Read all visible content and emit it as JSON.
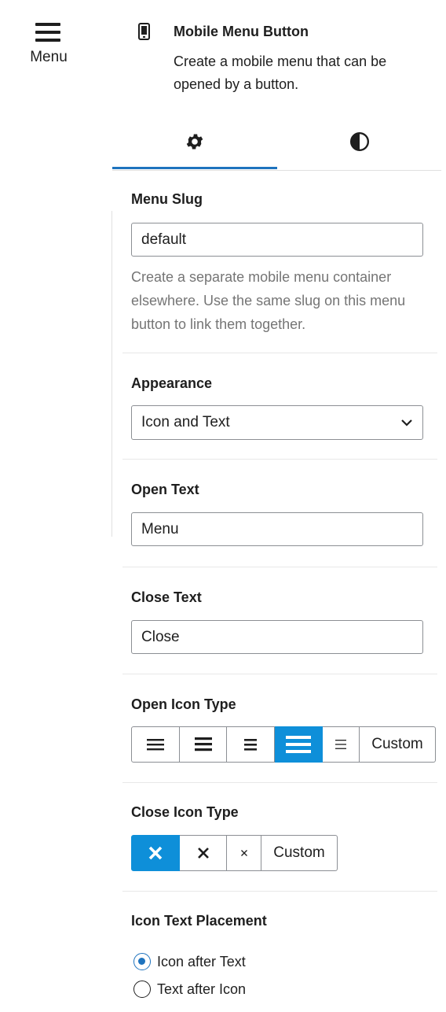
{
  "preview": {
    "label": "Menu",
    "icon": "hamburger-icon"
  },
  "block": {
    "title": "Mobile Menu Button",
    "description": "Create a mobile menu that can be opened by a button.",
    "icon": "mobile-device-icon"
  },
  "tabs": [
    {
      "name": "settings",
      "icon": "gear-icon",
      "active": true
    },
    {
      "name": "styles",
      "icon": "contrast-icon",
      "active": false
    }
  ],
  "panels": {
    "menu_slug": {
      "label": "Menu Slug",
      "value": "default",
      "help": "Create a separate mobile menu container elsewhere. Use the same slug on this menu button to link them together."
    },
    "appearance": {
      "label": "Appearance",
      "selected": "Icon and Text"
    },
    "open_text": {
      "label": "Open Text",
      "value": "Menu"
    },
    "close_text": {
      "label": "Close Text",
      "value": "Close"
    },
    "open_icon_type": {
      "label": "Open Icon Type",
      "options": [
        "menu-icon-1",
        "menu-icon-2",
        "menu-icon-3",
        "menu-icon-4",
        "menu-icon-5"
      ],
      "custom_label": "Custom",
      "selected_index": 3
    },
    "close_icon_type": {
      "label": "Close Icon Type",
      "options": [
        "close-icon-1",
        "close-icon-2",
        "close-icon-3"
      ],
      "custom_label": "Custom",
      "selected_index": 0
    },
    "icon_text_placement": {
      "label": "Icon Text Placement",
      "options": [
        "Icon after Text",
        "Text after Icon"
      ],
      "selected_index": 0
    }
  },
  "colors": {
    "accent": "#1e73be",
    "selected_button": "#0e8fd9",
    "help_text": "#757575"
  }
}
